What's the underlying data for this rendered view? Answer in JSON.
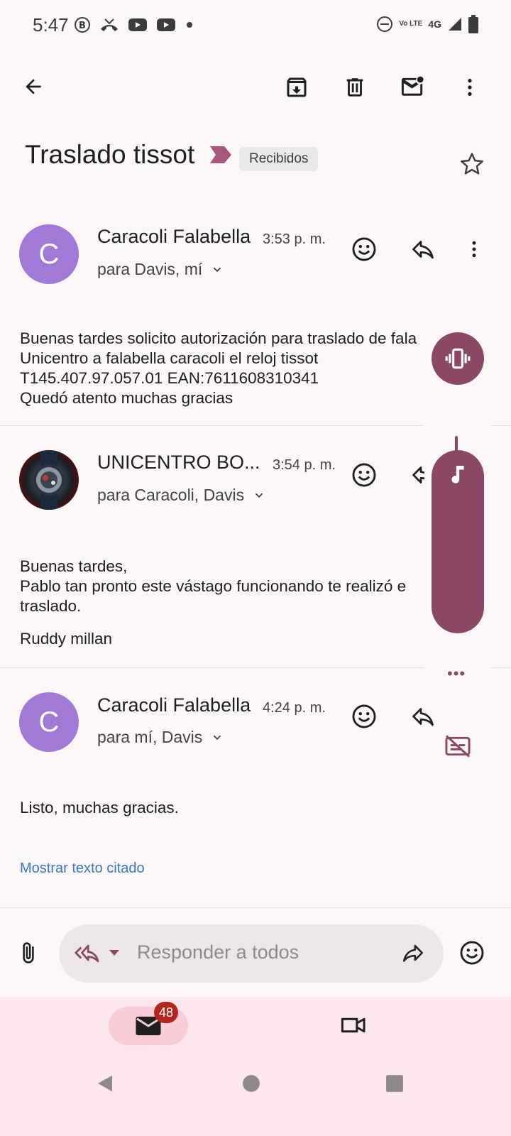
{
  "status_bar": {
    "time": "5:47",
    "network": "4G",
    "volte": "Vo LTE"
  },
  "toolbar": {
    "back_icon": "arrow-back-icon",
    "archive_icon": "archive-icon",
    "delete_icon": "trash-icon",
    "mark_unread_icon": "mark-unread-icon",
    "more_icon": "more-vert-icon"
  },
  "thread": {
    "subject": "Traslado tissot",
    "label": "Recibidos"
  },
  "messages": [
    {
      "sender": "Caracoli Falabella",
      "avatar_letter": "C",
      "time": "3:53 p. m.",
      "recipients": "para Davis, mí",
      "body": "Buenas tardes solicito autorización para traslado de fala\nUnicentro a falabella caracoli el reloj tissot\nT145.407.97.057.01 EAN:7611608310341\nQuedó atento muchas gracias"
    },
    {
      "sender": "UNICENTRO BO...",
      "time": "3:54 p. m.",
      "recipients": "para Caracoli, Davis",
      "body": "Buenas tardes,\nPablo tan pronto este vástago funcionando te realizó e\ntraslado.",
      "signature": "Ruddy millan"
    },
    {
      "sender": "Caracoli Falabella",
      "avatar_letter": "C",
      "time": "4:24 p. m.",
      "recipients": "para mí, Davis",
      "body": "Listo, muchas gracias.",
      "show_quoted": "Mostrar texto citado"
    }
  ],
  "reply": {
    "placeholder": "Responder a todos"
  },
  "bottom_nav": {
    "mail_badge": "48"
  },
  "colors": {
    "accent": "#8a4865",
    "avatar": "#a07ad6",
    "link": "#3a77c9",
    "badge": "#b3261e"
  }
}
